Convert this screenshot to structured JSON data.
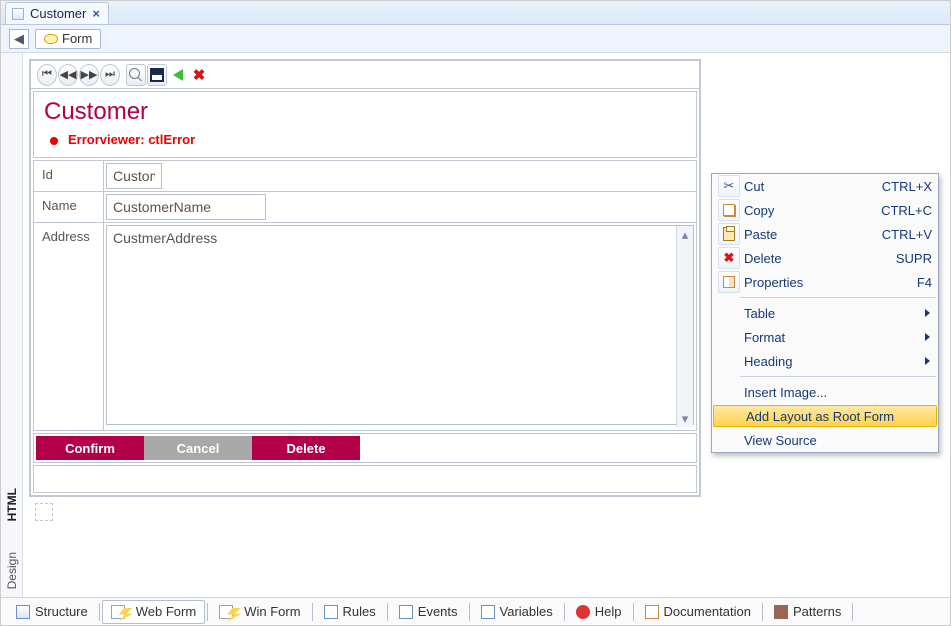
{
  "document_tab": {
    "title": "Customer",
    "close_glyph": "×"
  },
  "subbar": {
    "back_glyph": "◀",
    "form_label": "Form"
  },
  "toolbar_icons": {
    "first": "first-record-icon",
    "prev": "prev-record-icon",
    "next": "next-record-icon",
    "last": "last-record-icon",
    "search": "search-icon",
    "save": "save-icon",
    "undo": "undo-icon",
    "delete": "delete-icon"
  },
  "form": {
    "heading": "Customer",
    "error_text": "Errorviewer: ctlError",
    "fields": {
      "id": {
        "label": "Id",
        "value": "Customer"
      },
      "name": {
        "label": "Name",
        "value": "CustomerName"
      },
      "address": {
        "label": "Address",
        "value": "CustmerAddress"
      }
    },
    "buttons": {
      "confirm": "Confirm",
      "cancel": "Cancel",
      "delete": "Delete"
    }
  },
  "side_tabs": {
    "design": "Design",
    "html": "HTML"
  },
  "context_menu": {
    "items": [
      {
        "id": "cut",
        "label": "Cut",
        "accel": "CTRL+X",
        "icon": "cut-icon"
      },
      {
        "id": "copy",
        "label": "Copy",
        "accel": "CTRL+C",
        "icon": "copy-icon"
      },
      {
        "id": "paste",
        "label": "Paste",
        "accel": "CTRL+V",
        "icon": "paste-icon"
      },
      {
        "id": "delete",
        "label": "Delete",
        "accel": "SUPR",
        "icon": "delete-icon"
      },
      {
        "id": "properties",
        "label": "Properties",
        "accel": "F4",
        "icon": "properties-icon"
      },
      {
        "divider": true
      },
      {
        "id": "table",
        "label": "Table",
        "submenu": true
      },
      {
        "id": "format",
        "label": "Format",
        "submenu": true
      },
      {
        "id": "heading",
        "label": "Heading",
        "submenu": true
      },
      {
        "divider": true
      },
      {
        "id": "insert-image",
        "label": "Insert Image..."
      },
      {
        "id": "add-layout",
        "label": "Add Layout as Root Form",
        "highlight": true
      },
      {
        "id": "view-source",
        "label": "View Source"
      }
    ]
  },
  "bottom_tabs": [
    {
      "id": "structure",
      "label": "Structure"
    },
    {
      "id": "web-form",
      "label": "Web Form",
      "active": true
    },
    {
      "id": "win-form",
      "label": "Win Form"
    },
    {
      "id": "rules",
      "label": "Rules"
    },
    {
      "id": "events",
      "label": "Events"
    },
    {
      "id": "variables",
      "label": "Variables"
    },
    {
      "id": "help",
      "label": "Help"
    },
    {
      "id": "documentation",
      "label": "Documentation"
    },
    {
      "id": "patterns",
      "label": "Patterns"
    }
  ]
}
